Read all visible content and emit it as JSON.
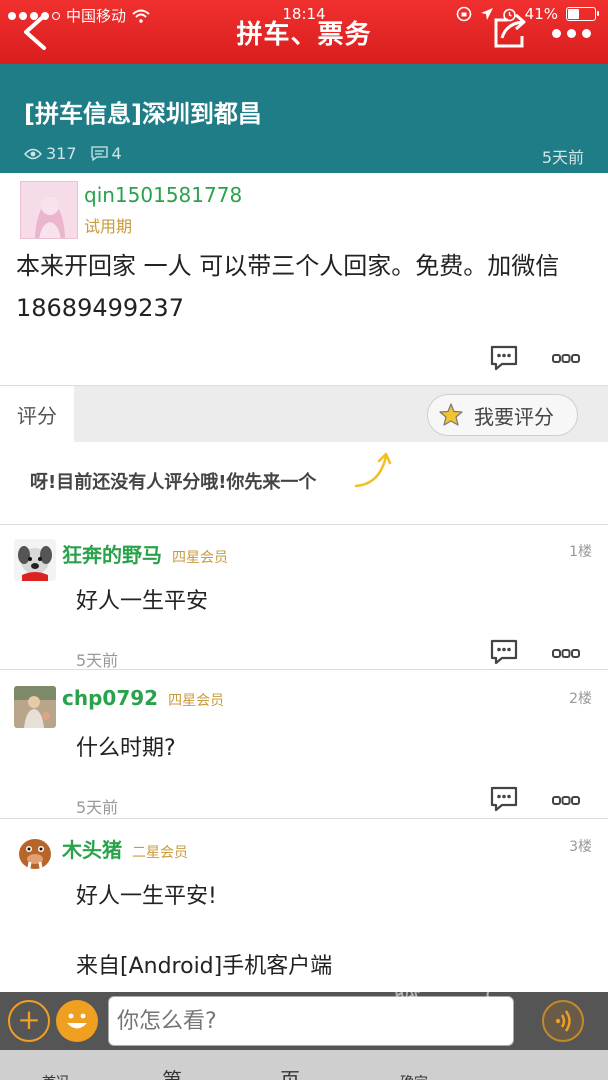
{
  "status_bar": {
    "carrier": "中国移动",
    "time": "18:14",
    "battery": "41%",
    "battery_level": 0.41
  },
  "nav": {
    "title": "拼车、票务"
  },
  "thread": {
    "title": "[拼车信息]深圳到都昌",
    "views": "317",
    "replies": "4",
    "time": "5天前"
  },
  "op": {
    "username": "qin1501581778",
    "level": "试用期",
    "content": "本来开回家 一人 可以带三个人回家。免费。加微信18689499237"
  },
  "rating": {
    "label": "评分",
    "button": "我要评分",
    "empty_text": "呀!目前还没有人评分哦!你先来一个"
  },
  "comments": [
    {
      "username": "狂奔的野马",
      "level": "四星会员",
      "floor": "1楼",
      "text": "好人一生平安",
      "time": "5天前"
    },
    {
      "username": "chp0792",
      "level": "四星会员",
      "floor": "2楼",
      "text": "什么时期?",
      "time": "5天前"
    },
    {
      "username": "木头猪",
      "level": "二星会员",
      "floor": "3楼",
      "text": "好人一生平安!",
      "text2": "来自[Android]手机客户端"
    }
  ],
  "input": {
    "placeholder": "你怎么看?"
  },
  "footer": {
    "item1": "首冯",
    "item2": "第",
    "item3": "页",
    "item4": "确定"
  },
  "watermark": {
    "text": "脚本之家",
    "sub": "ng.c"
  },
  "colors": {
    "nav_red": "#e42a27",
    "header_teal": "#1e7d86",
    "username_green": "#2aa24c",
    "level_gold": "#c99a3d"
  }
}
